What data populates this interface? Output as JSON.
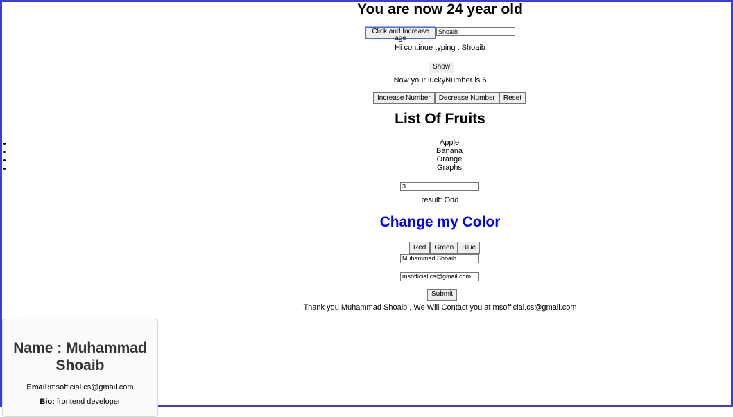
{
  "age": {
    "heading": "You are now 24 year old",
    "button_label": "Click and Increase age"
  },
  "typing": {
    "input_value": "Shoaib",
    "message": "Hi continue typing : Shoaib"
  },
  "show": {
    "button_label": "Show"
  },
  "lucky": {
    "message": "Now your luckyNumber is 6",
    "increase_label": "Increase Number",
    "decrease_label": "Decrease Number",
    "reset_label": "Reset"
  },
  "fruits": {
    "heading": "List Of Fruits",
    "items": [
      "Apple",
      "Banana",
      "Orange",
      "Graphs"
    ]
  },
  "parity": {
    "input_value": "3",
    "result": "result: Odd"
  },
  "color": {
    "heading": "Change my Color",
    "current_color": "#0000ff",
    "red_label": "Red",
    "green_label": "Green",
    "blue_label": "Blue"
  },
  "form": {
    "name_value": "Muhammad Shoaib",
    "email_value": "msofficial.cs@gmail.com",
    "submit_label": "Submit",
    "thanks": "Thank you Muhammad Shoaib , We Will Contact you at msofficial.cs@gmail.com"
  },
  "profile": {
    "name": "Name : Muhammad Shoaib",
    "email_label": "Email:",
    "email_value": "msofficial.cs@gmail.com",
    "bio_label": "Bio:",
    "bio_value": " frontend developer"
  },
  "colors": {
    "frame": "#3b3fd6",
    "heading_blue": "#0000ff"
  }
}
